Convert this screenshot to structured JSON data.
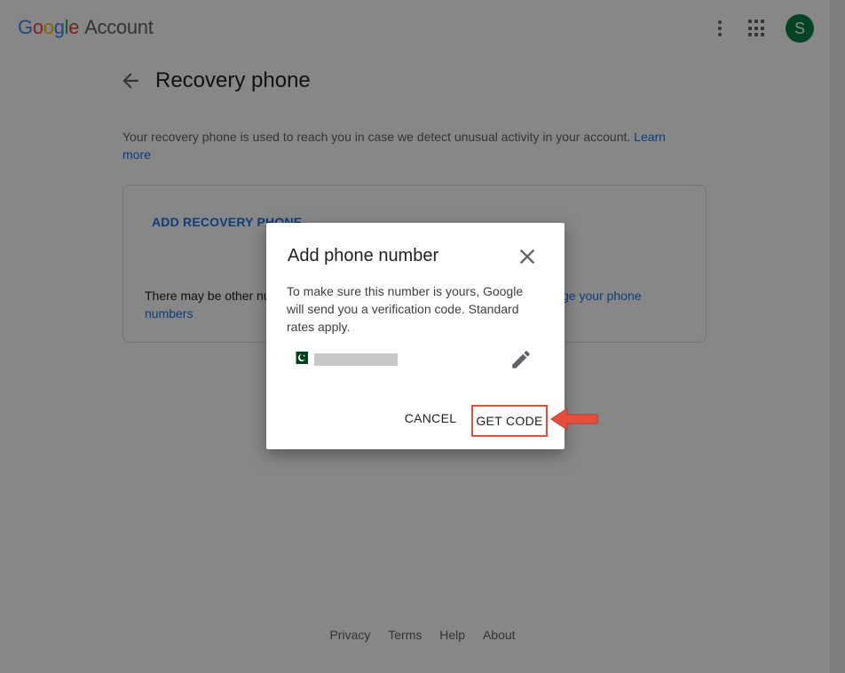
{
  "header": {
    "logo_letters": [
      "G",
      "o",
      "o",
      "g",
      "l",
      "e"
    ],
    "logo_suffix": "Account",
    "avatar_initial": "S",
    "avatar_color": "#0b8043"
  },
  "page": {
    "title": "Recovery phone",
    "description": "Your recovery phone is used to reach you in case we detect unusual activity in your account.",
    "learn_more": "Learn more"
  },
  "card": {
    "add_phone_label": "ADD RECOVERY PHONE",
    "note_start": "There may be other nu",
    "note_link_end": "ge your phone",
    "note_link_numbers": "numbers"
  },
  "dialog": {
    "title": "Add phone number",
    "body": "To make sure this number is yours, Google will send you a verification code. Standard rates apply.",
    "cancel_label": "CANCEL",
    "get_code_label": "GET CODE",
    "flag_icon": "pakistan-flag-icon",
    "highlight_color": "#e84c3d"
  },
  "footer": {
    "links": [
      "Privacy",
      "Terms",
      "Help",
      "About"
    ]
  },
  "colors": {
    "link": "#1a73e8",
    "overlay": "rgba(0,0,0,0.47)"
  }
}
